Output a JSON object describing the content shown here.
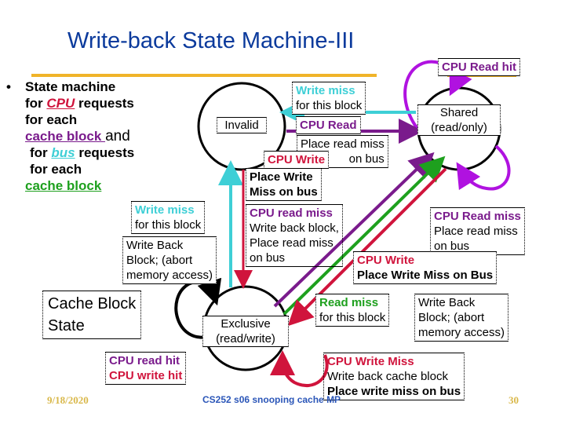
{
  "slide": {
    "title": "Write-back State Machine-III",
    "bullets": {
      "bullet_glyph": "•",
      "line1": "State machine",
      "line2_pre": "for ",
      "line2_cpu": "CPU",
      "line2_post": " requests",
      "line3": "for each",
      "line4_link": "cache block ",
      "line4_post": "and",
      "line5_pre": "for ",
      "line5_bus": "bus",
      "line5_post": " requests",
      "line6": "for each",
      "line7_link": "cache block"
    },
    "legend_box": {
      "line1": "Cache Block",
      "line2": "State"
    },
    "states": {
      "invalid": {
        "label": "Invalid"
      },
      "shared": {
        "line1": "Shared",
        "line2": "(read/only)"
      },
      "exclusive": {
        "line1": "Exclusive",
        "line2": "(read/write)"
      }
    },
    "transitions": {
      "shared_self": {
        "label": "CPU Read hit"
      },
      "shared_to_invalid": {
        "line1": "Write miss",
        "line2": "for this block"
      },
      "invalid_to_shared": {
        "line1": "CPU Read",
        "line2": "Place read miss",
        "line3": "on bus"
      },
      "invalid_to_exclusive": {
        "line1": "CPU Write",
        "line2": "Place Write",
        "line3": "Miss on bus"
      },
      "exclusive_to_invalid": {
        "line1": "Write miss",
        "line2": "for this block",
        "line3": "Write Back",
        "line4": "Block; (abort",
        "line5": "memory access)"
      },
      "exclusive_to_shared_cpu": {
        "line1": "CPU read miss",
        "line2": "Write back block,",
        "line3": "Place read miss",
        "line4": "on bus"
      },
      "shared_self_miss": {
        "line1": "CPU Read miss",
        "line2": "Place read miss",
        "line3": "on bus"
      },
      "shared_to_exclusive": {
        "line1": "CPU Write",
        "line2": "Place Write Miss on Bus"
      },
      "exclusive_to_shared_bus": {
        "line1": "Read miss",
        "line2": "for this block",
        "line3": "Write Back",
        "line4": "Block; (abort",
        "line5": "memory access)"
      },
      "exclusive_self_hit": {
        "line1": "CPU read hit",
        "line2": "CPU write hit"
      },
      "exclusive_self_miss": {
        "line1": "CPU Write Miss",
        "line2": "Write back cache block",
        "line3": "Place write miss on bus"
      }
    },
    "colors": {
      "title": "#0b3a9c",
      "rule": "#f0b429",
      "cpu_read": "#7a1b8c",
      "cpu_write": "#d0143c",
      "bus_write_miss": "#3ecfd6",
      "bus_read_miss": "#1ea01e",
      "self_loop": "#b012e0"
    },
    "footer": {
      "date": "9/18/2020",
      "course": "CS252 s06 snooping cache MP",
      "page": "30"
    }
  }
}
